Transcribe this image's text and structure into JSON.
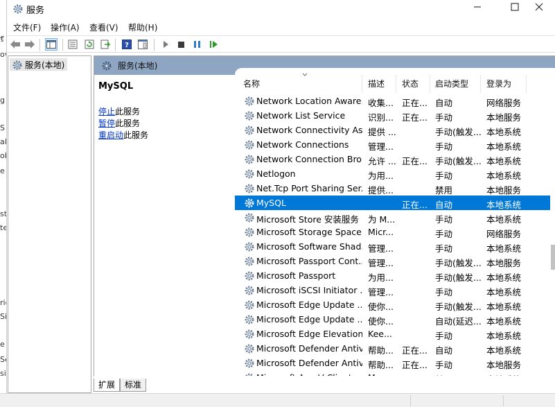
{
  "window": {
    "title": "服务"
  },
  "menu": [
    "文件(F)",
    "操作(A)",
    "查看(V)",
    "帮助(H)"
  ],
  "edge_chars": [
    "ӻ",
    "ov",
    "g",
    "S",
    "all",
    "ob",
    "e",
    "st",
    "te",
    "rio",
    "Sin",
    "e",
    "Se",
    "si"
  ],
  "tree": {
    "root_label": "服务(本地)"
  },
  "panel": {
    "header": "服务(本地)",
    "selected_service": "MySQL",
    "actions": [
      {
        "link": "停止",
        "rest": "此服务"
      },
      {
        "link": "暂停",
        "rest": "此服务"
      },
      {
        "link": "重启动",
        "rest": "此服务"
      }
    ]
  },
  "columns": [
    "名称",
    "描述",
    "状态",
    "启动类型",
    "登录为"
  ],
  "services": [
    {
      "name": "Network Location Aware...",
      "desc": "收集...",
      "status": "正在...",
      "startup": "自动",
      "logon": "网络服务"
    },
    {
      "name": "Network List Service",
      "desc": "识别...",
      "status": "正在...",
      "startup": "手动",
      "logon": "本地服务"
    },
    {
      "name": "Network Connectivity Ass...",
      "desc": "提供 ...",
      "status": "",
      "startup": "手动(触发...",
      "logon": "本地系统"
    },
    {
      "name": "Network Connections",
      "desc": "管理...",
      "status": "",
      "startup": "手动",
      "logon": "本地系统"
    },
    {
      "name": "Network Connection Bro...",
      "desc": "允许 ...",
      "status": "正在...",
      "startup": "手动(触发...",
      "logon": "本地系统"
    },
    {
      "name": "Netlogon",
      "desc": "为用...",
      "status": "",
      "startup": "手动",
      "logon": "本地系统"
    },
    {
      "name": "Net.Tcp Port Sharing Ser...",
      "desc": "提供...",
      "status": "",
      "startup": "禁用",
      "logon": "本地服务"
    },
    {
      "name": "MySQL",
      "desc": "",
      "status": "正在...",
      "startup": "自动",
      "logon": "本地系统",
      "selected": true
    },
    {
      "name": "Microsoft Store 安装服务",
      "desc": "为 M...",
      "status": "",
      "startup": "手动",
      "logon": "本地系统"
    },
    {
      "name": "Microsoft Storage Space...",
      "desc": "Micr...",
      "status": "",
      "startup": "手动",
      "logon": "网络服务"
    },
    {
      "name": "Microsoft Software Shad...",
      "desc": "管理...",
      "status": "",
      "startup": "手动",
      "logon": "本地系统"
    },
    {
      "name": "Microsoft Passport Cont...",
      "desc": "管理...",
      "status": "",
      "startup": "手动(触发...",
      "logon": "本地服务"
    },
    {
      "name": "Microsoft Passport",
      "desc": "为用...",
      "status": "",
      "startup": "手动(触发...",
      "logon": "本地系统"
    },
    {
      "name": "Microsoft iSCSI Initiator ...",
      "desc": "管理...",
      "status": "",
      "startup": "手动",
      "logon": "本地系统"
    },
    {
      "name": "Microsoft Edge Update ...",
      "desc": "使你...",
      "status": "",
      "startup": "手动(触发...",
      "logon": "本地系统"
    },
    {
      "name": "Microsoft Edge Update ...",
      "desc": "使你...",
      "status": "",
      "startup": "自动(延迟...",
      "logon": "本地系统"
    },
    {
      "name": "Microsoft Edge Elevation...",
      "desc": "Kee...",
      "status": "",
      "startup": "手动",
      "logon": "本地系统"
    },
    {
      "name": "Microsoft Defender Antiv...",
      "desc": "帮助...",
      "status": "正在...",
      "startup": "自动",
      "logon": "本地系统"
    },
    {
      "name": "Microsoft Defender Antiv...",
      "desc": "帮助...",
      "status": "正在...",
      "startup": "手动",
      "logon": "本地服务"
    },
    {
      "name": "Microsoft App-V Client",
      "desc": "Man...",
      "status": "",
      "startup": "禁用",
      "logon": "本地系统"
    }
  ],
  "tabs": [
    "扩展",
    "标准"
  ],
  "colors": {
    "selection": "#0078d7",
    "header_band": "#8fa6c2",
    "link": "#0033cc"
  }
}
